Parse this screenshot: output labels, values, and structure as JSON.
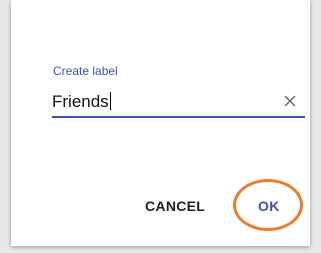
{
  "dialog": {
    "field_label": "Create label",
    "input_value": "Friends",
    "clear_icon": "close-icon",
    "cancel_label": "CANCEL",
    "ok_label": "OK"
  },
  "colors": {
    "accent": "#3f51b5",
    "highlight": "#ee7d2a",
    "text": "#202020"
  }
}
